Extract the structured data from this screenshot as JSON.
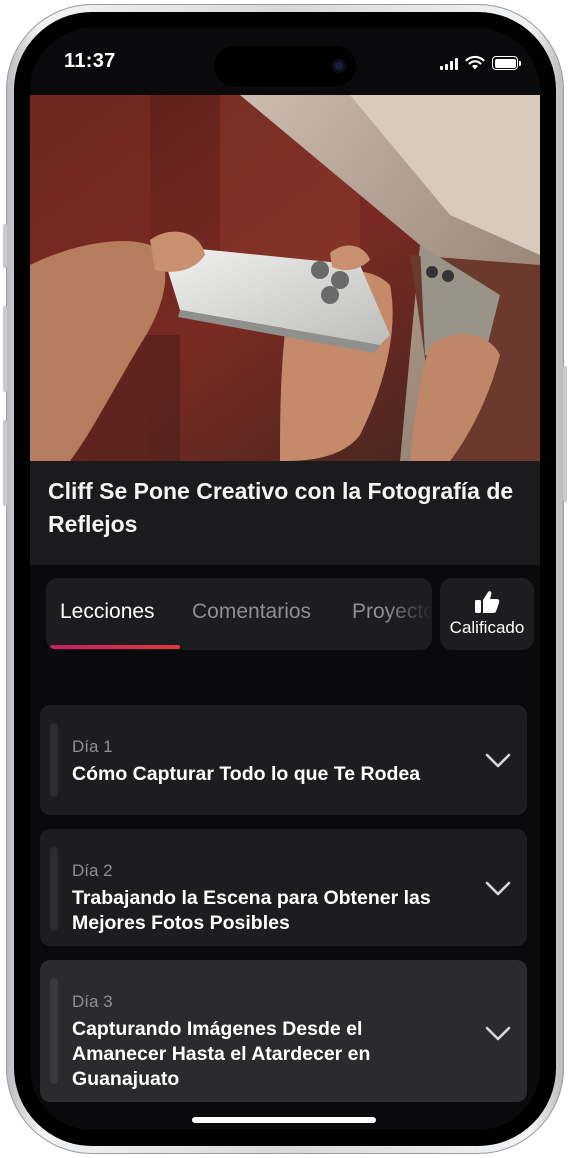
{
  "status_bar": {
    "time": "11:37"
  },
  "hero": {
    "title": "Cliff Se Pone Creativo con la Fotografía de Reflejos"
  },
  "tabs": [
    {
      "label": "Lecciones",
      "active": true
    },
    {
      "label": "Comentarios",
      "active": false
    },
    {
      "label": "Proyectos",
      "active": false
    }
  ],
  "rating": {
    "label": "Calificado",
    "icon": "thumbs-up-icon"
  },
  "lessons": [
    {
      "day": "Día 1",
      "title": "Cómo Capturar Todo lo que Te Rodea"
    },
    {
      "day": "Día 2",
      "title": "Trabajando la Escena para Obtener las Mejores Fotos Posibles"
    },
    {
      "day": "Día 3",
      "title": "Capturando Imágenes Desde el Amanecer Hasta el Atardecer en Guanajuato"
    }
  ],
  "colors": {
    "accent_start": "#c81e6a",
    "accent_end": "#e03a3a",
    "background": "#0a0a0c",
    "card": "#1d1d1f"
  }
}
